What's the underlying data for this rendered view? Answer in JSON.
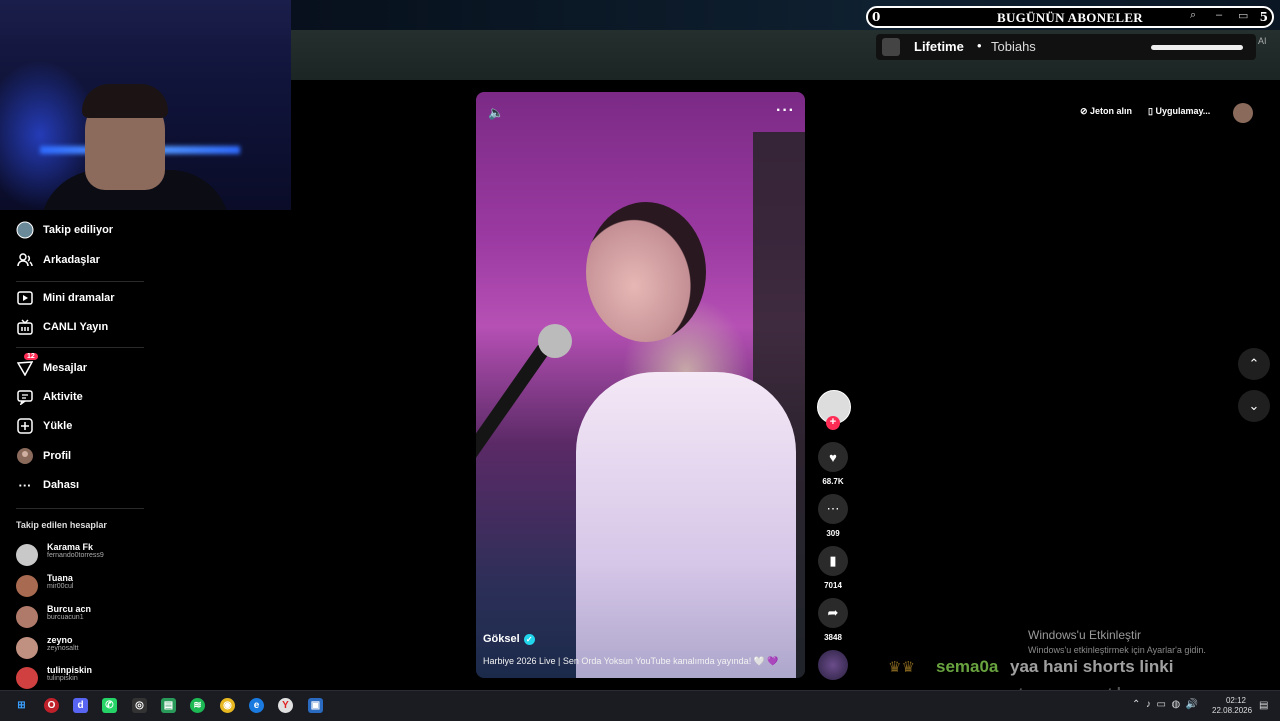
{
  "overlay": {
    "subs_count": "0",
    "subs_title": "BUGÜNÜN ABONELER",
    "subs_right": "5",
    "lifetime_label": "Lifetime",
    "lifetime_dot": "•",
    "lifetime_name": "Tobiahs",
    "ai_label": "AI"
  },
  "sidebar": {
    "items": [
      {
        "label": "Takip ediliyor",
        "icon": "following-avatar-icon"
      },
      {
        "label": "Arkadaşlar",
        "icon": "friends-icon"
      },
      {
        "label": "Mini dramalar",
        "icon": "mini-drama-icon"
      },
      {
        "label": "CANLI Yayın",
        "icon": "live-icon"
      },
      {
        "label": "Mesajlar",
        "icon": "messages-icon",
        "badge": "12"
      },
      {
        "label": "Aktivite",
        "icon": "activity-icon"
      },
      {
        "label": "Yükle",
        "icon": "upload-icon"
      },
      {
        "label": "Profil",
        "icon": "profile-avatar-icon"
      },
      {
        "label": "Dahası",
        "icon": "more-dots-icon"
      }
    ],
    "followed_title": "Takip edilen hesaplar",
    "accounts": [
      {
        "name": "Karama Fk",
        "handle": "fernando0torress9",
        "color": "#c8c8c8"
      },
      {
        "name": "Tuana",
        "handle": "mir00cul",
        "color": "#a86a50"
      },
      {
        "name": "Burcu acn",
        "handle": "burcuacun1",
        "color": "#b07a6a"
      },
      {
        "name": "zeyno",
        "handle": "zeynosaltt",
        "color": "#c09080"
      },
      {
        "name": "tulinpiskin",
        "handle": "tulinpiskin",
        "color": "#d04040"
      }
    ]
  },
  "video": {
    "author": "Göksel",
    "caption": "Harbiye 2026 Live | Sen Orda Yoksun YouTube kanalımda yayında! 🤍 💜"
  },
  "actions": {
    "likes": "68.7K",
    "comments": "309",
    "saves": "7014",
    "shares": "3848"
  },
  "site_header": {
    "coins": "Jeton alın",
    "get_app": "Uygulamay..."
  },
  "windows": {
    "activate_title": "Windows'u Etkinleştir",
    "activate_sub": "Windows'u etkinleştirmek için Ayarlar'a gidin.",
    "clock_time": "02:12",
    "clock_date": "22.08.2026"
  },
  "chat": {
    "user": "sema0a",
    "message_line1": "yaa hani shorts linki",
    "message_line2": "atamıyoruz artık"
  },
  "colors": {
    "accent": "#fe2c55",
    "verified": "#20d5ec",
    "chat_user": "#7cc04a"
  }
}
